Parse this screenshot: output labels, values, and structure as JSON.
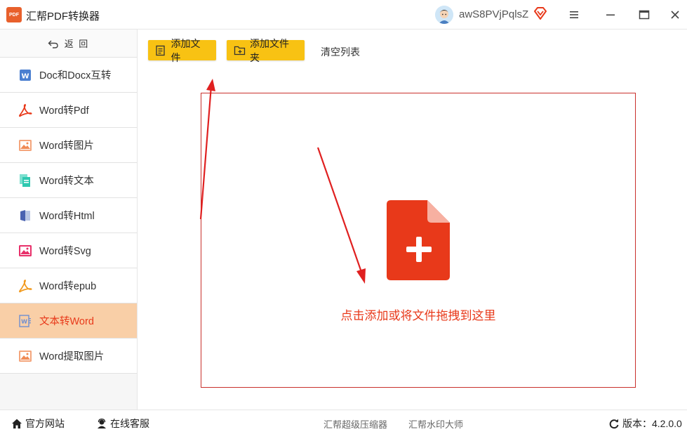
{
  "app": {
    "logo_text": "PDF",
    "title": "汇帮PDF转换器"
  },
  "user": {
    "name": "awS8PVjPqlsZ"
  },
  "sidebar": {
    "back_label": "返  回",
    "items": [
      {
        "label": "Doc和Docx互转",
        "icon": "word-icon"
      },
      {
        "label": "Word转Pdf",
        "icon": "pdf-icon"
      },
      {
        "label": "Word转图片",
        "icon": "image-icon"
      },
      {
        "label": "Word转文本",
        "icon": "text-file-icon"
      },
      {
        "label": "Word转Html",
        "icon": "html-icon"
      },
      {
        "label": "Word转Svg",
        "icon": "svg-icon"
      },
      {
        "label": "Word转epub",
        "icon": "epub-icon"
      },
      {
        "label": "文本转Word",
        "icon": "word-outline-icon",
        "active": true
      },
      {
        "label": "Word提取图片",
        "icon": "image-icon"
      }
    ]
  },
  "toolbar": {
    "add_file_label": "添加文件",
    "add_folder_label": "添加文件夹",
    "clear_list_label": "清空列表"
  },
  "dropzone": {
    "hint": "点击添加或将文件拖拽到这里"
  },
  "footer": {
    "website_label": "官方网站",
    "support_label": "在线客服",
    "link1": "汇帮超级压缩器",
    "link2": "汇帮水印大师",
    "version_label": "版本：4.2.0.0"
  },
  "colors": {
    "accent": "#f8c213",
    "active_bg": "#f9cfa7",
    "red": "#e8391a"
  }
}
